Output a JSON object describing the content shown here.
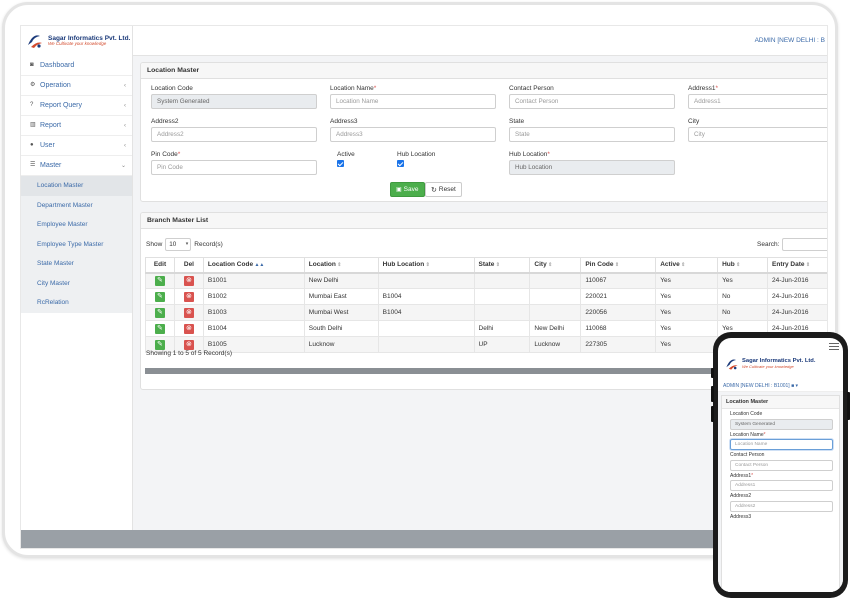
{
  "brand": {
    "name": "Sagar Informatics Pvt. Ltd.",
    "tagline": "We Cultivate your knowledge"
  },
  "topbar": {
    "user": "ADMIN [NEW DELHI : B"
  },
  "sidebar": {
    "items": [
      {
        "label": "Dashboard",
        "icon": "dashboard-icon",
        "chevron": ""
      },
      {
        "label": "Operation",
        "icon": "gear-icon",
        "chevron": "‹"
      },
      {
        "label": "Report Query",
        "icon": "question-icon",
        "chevron": "‹"
      },
      {
        "label": "Report",
        "icon": "bar-chart-icon",
        "chevron": "‹"
      },
      {
        "label": "User",
        "icon": "users-icon",
        "chevron": "‹"
      },
      {
        "label": "Master",
        "icon": "list-icon",
        "chevron": "⌄"
      }
    ],
    "submenu": [
      "Location Master",
      "Department Master",
      "Employee Master",
      "Employee Type Master",
      "State Master",
      "City Master",
      "RcRelation"
    ]
  },
  "form": {
    "title": "Location Master",
    "location_code": {
      "label": "Location Code",
      "value": "System Generated"
    },
    "location_name": {
      "label": "Location Name",
      "placeholder": "Location Name"
    },
    "contact_person": {
      "label": "Contact Person",
      "placeholder": "Contact Person"
    },
    "address1": {
      "label": "Address1",
      "placeholder": "Address1"
    },
    "address2": {
      "label": "Address2",
      "placeholder": "Address2"
    },
    "address3": {
      "label": "Address3",
      "placeholder": "Address3"
    },
    "state": {
      "label": "State",
      "placeholder": "State"
    },
    "city": {
      "label": "City",
      "placeholder": "City"
    },
    "pin_code": {
      "label": "Pin Code",
      "placeholder": "Pin Code"
    },
    "active": {
      "label": "Active"
    },
    "hub_location_chk": {
      "label": "Hub Location"
    },
    "hub_location": {
      "label": "Hub Location",
      "value": "Hub Location"
    },
    "save_label": "Save",
    "reset_label": "Reset",
    "required_mark": "*"
  },
  "list": {
    "title": "Branch Master List",
    "show_label": "Show",
    "page_size": "10",
    "records_label": "Record(s)",
    "search_label": "Search:",
    "headers": [
      "Edit",
      "Del",
      "Location Code",
      "Location",
      "Hub Location",
      "State",
      "City",
      "Pin Code",
      "Active",
      "Hub",
      "Entry Date"
    ],
    "rows": [
      [
        "B1001",
        "New Delhi",
        "",
        "",
        "",
        "110067",
        "Yes",
        "Yes",
        "24-Jun-2016"
      ],
      [
        "B1002",
        "Mumbai East",
        "B1004",
        "",
        "",
        "220021",
        "Yes",
        "No",
        "24-Jun-2016"
      ],
      [
        "B1003",
        "Mumbai West",
        "B1004",
        "",
        "",
        "220056",
        "Yes",
        "No",
        "24-Jun-2016"
      ],
      [
        "B1004",
        "South Delhi",
        "",
        "Delhi",
        "New Delhi",
        "110068",
        "Yes",
        "Yes",
        "24-Jun-2016"
      ],
      [
        "B1005",
        "Lucknow",
        "",
        "UP",
        "Lucknow",
        "227305",
        "Yes",
        "",
        ""
      ]
    ],
    "footer": "Showing 1 to 5 of 5 Record(s)"
  },
  "phone": {
    "user": "ADMIN [NEW DELHI : B1001]",
    "fields": [
      {
        "label": "Location Code",
        "value": "System Generated",
        "req": false,
        "disabled": true
      },
      {
        "label": "Location Name",
        "value": "Location Name",
        "req": true,
        "focus": true
      },
      {
        "label": "Contact Person",
        "value": "Contact Person",
        "req": false
      },
      {
        "label": "Address1",
        "value": "Address1",
        "req": true
      },
      {
        "label": "Address2",
        "value": "Address2",
        "req": false
      },
      {
        "label": "Address3",
        "value": "",
        "req": false
      }
    ]
  },
  "colors": {
    "accent": "#3b6aa8",
    "save": "#4cae4c",
    "delete": "#d9534f",
    "required": "#d9534f"
  }
}
